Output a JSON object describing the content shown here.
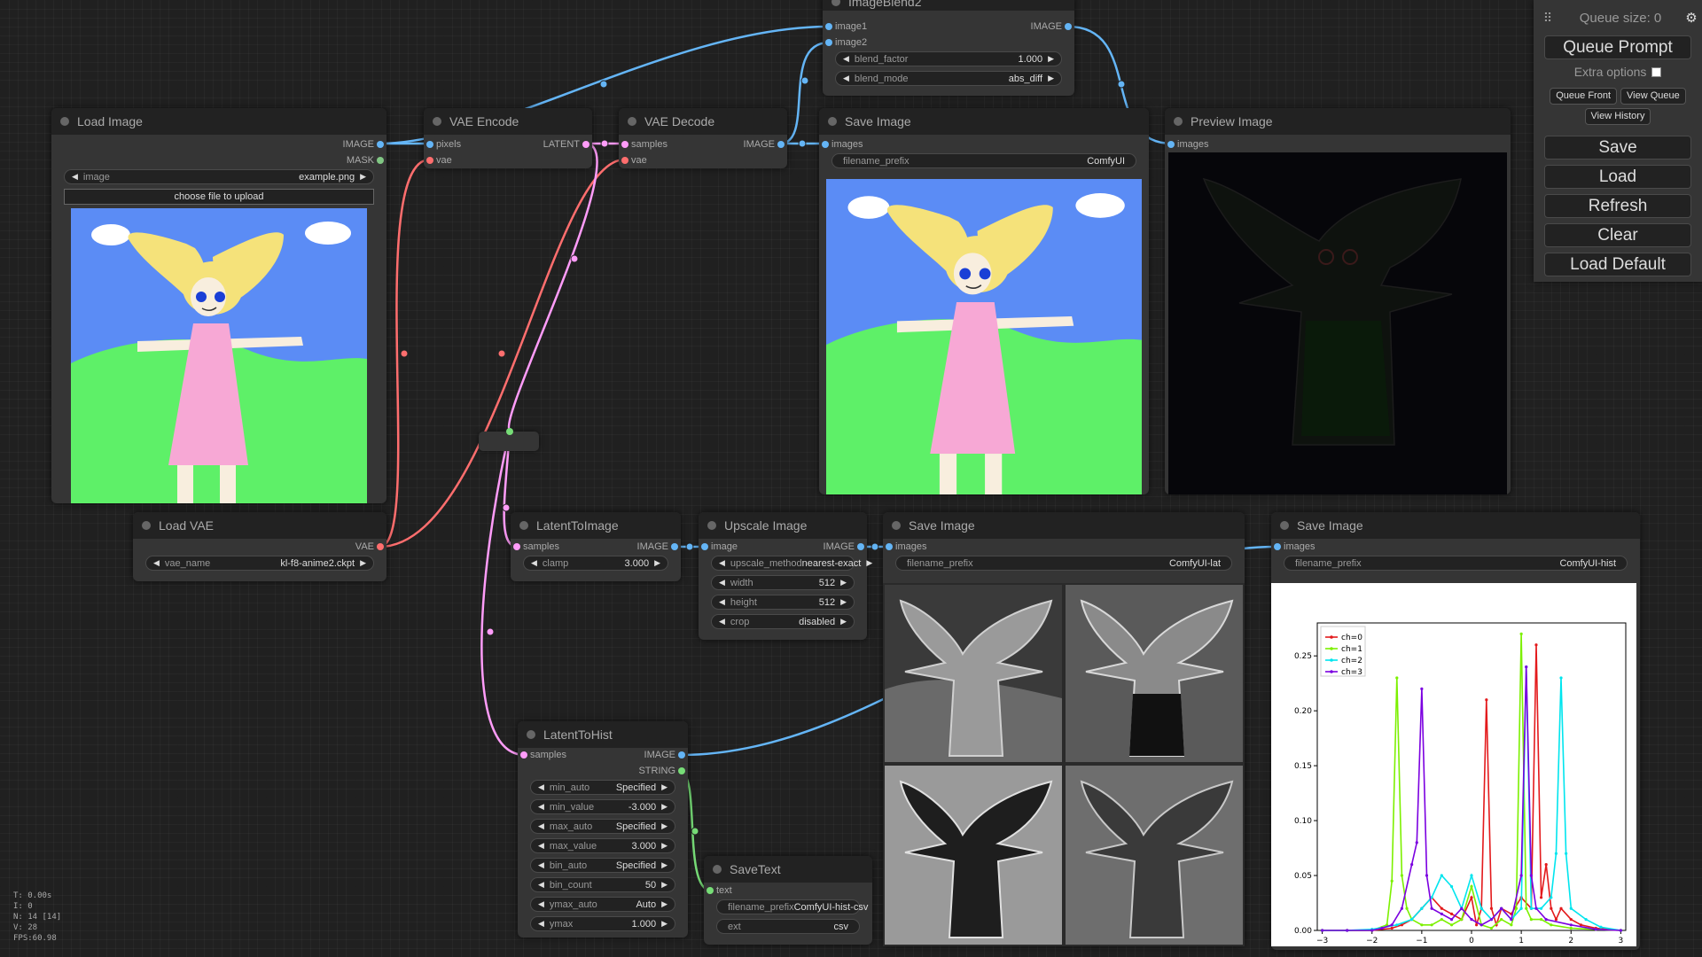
{
  "menu": {
    "queue_size": "Queue size: 0",
    "queue_prompt": "Queue Prompt",
    "extra_options": "Extra options",
    "queue_front": "Queue Front",
    "view_queue": "View Queue",
    "view_history": "View History",
    "save": "Save",
    "load": "Load",
    "refresh": "Refresh",
    "clear": "Clear",
    "load_default": "Load Default"
  },
  "stats": {
    "t": "T: 0.00s",
    "i": "I: 0",
    "n": "N: 14 [14]",
    "v": "V: 28",
    "fps": "FPS:60.98"
  },
  "nodes": {
    "load_image": {
      "title": "Load Image",
      "out_image": "IMAGE",
      "out_mask": "MASK",
      "w_image_name": "image",
      "w_image_value": "example.png",
      "upload": "choose file to upload"
    },
    "load_vae": {
      "title": "Load VAE",
      "out_vae": "VAE",
      "w_vae_name": "vae_name",
      "w_vae_value": "kl-f8-anime2.ckpt"
    },
    "vae_encode": {
      "title": "VAE Encode",
      "in_pixels": "pixels",
      "in_vae": "vae",
      "out_latent": "LATENT"
    },
    "vae_decode": {
      "title": "VAE Decode",
      "in_samples": "samples",
      "in_vae": "vae",
      "out_image": "IMAGE"
    },
    "image_blend": {
      "title": "ImageBlend2",
      "in_image1": "image1",
      "in_image2": "image2",
      "out_image": "IMAGE",
      "w_blend_factor": "blend_factor",
      "w_blend_factor_value": "1.000",
      "w_blend_mode": "blend_mode",
      "w_blend_mode_value": "abs_diff"
    },
    "save_image_1": {
      "title": "Save Image",
      "in_images": "images",
      "w_prefix": "filename_prefix",
      "w_prefix_value": "ComfyUI"
    },
    "preview_image": {
      "title": "Preview Image",
      "in_images": "images"
    },
    "latent_to_image": {
      "title": "LatentToImage",
      "in_samples": "samples",
      "out_image": "IMAGE",
      "w_clamp": "clamp",
      "w_clamp_value": "3.000"
    },
    "upscale_image": {
      "title": "Upscale Image",
      "in_image": "image",
      "out_image": "IMAGE",
      "widgets": [
        {
          "name": "upscale_method",
          "value": "nearest-exact"
        },
        {
          "name": "width",
          "value": "512"
        },
        {
          "name": "height",
          "value": "512"
        },
        {
          "name": "crop",
          "value": "disabled"
        }
      ]
    },
    "save_image_lat": {
      "title": "Save Image",
      "in_images": "images",
      "w_prefix": "filename_prefix",
      "w_prefix_value": "ComfyUI-lat"
    },
    "save_image_hist": {
      "title": "Save Image",
      "in_images": "images",
      "w_prefix": "filename_prefix",
      "w_prefix_value": "ComfyUI-hist"
    },
    "latent_to_hist": {
      "title": "LatentToHist",
      "in_samples": "samples",
      "out_image": "IMAGE",
      "out_string": "STRING",
      "widgets": [
        {
          "name": "min_auto",
          "value": "Specified"
        },
        {
          "name": "min_value",
          "value": "-3.000"
        },
        {
          "name": "max_auto",
          "value": "Specified"
        },
        {
          "name": "max_value",
          "value": "3.000"
        },
        {
          "name": "bin_auto",
          "value": "Specified"
        },
        {
          "name": "bin_count",
          "value": "50"
        },
        {
          "name": "ymax_auto",
          "value": "Auto"
        },
        {
          "name": "ymax",
          "value": "1.000"
        }
      ]
    },
    "save_text": {
      "title": "SaveText",
      "in_text": "text",
      "w_prefix": "filename_prefix",
      "w_prefix_value": "ComfyUI-hist-csv",
      "w_ext": "ext",
      "w_ext_value": "csv"
    }
  },
  "colors": {
    "image_link": "#64b5f6",
    "vae_link": "#ff6e6e",
    "latent_link": "#ff9cf9",
    "string_link": "#77dd77"
  },
  "chart_data": {
    "type": "line",
    "x_ticks": [
      "−3",
      "−2",
      "−1",
      "0",
      "1",
      "2",
      "3"
    ],
    "y_ticks": [
      "0.00",
      "0.05",
      "0.10",
      "0.15",
      "0.20",
      "0.25"
    ],
    "xlim": [
      -3.1,
      3.1
    ],
    "ylim": [
      0,
      0.28
    ],
    "legend_position": "top-left",
    "series": [
      {
        "name": "ch=0",
        "color": "#e31a1c",
        "x": [
          -3.0,
          -2.5,
          -2.0,
          -1.6,
          -1.4,
          -1.2,
          -1.0,
          -0.8,
          -0.6,
          -0.4,
          -0.2,
          0.0,
          0.1,
          0.2,
          0.3,
          0.4,
          0.5,
          0.6,
          0.8,
          1.0,
          1.2,
          1.3,
          1.4,
          1.5,
          1.6,
          1.7,
          1.8,
          2.0,
          2.2,
          2.5,
          3.0
        ],
        "y": [
          0,
          0,
          0,
          0.002,
          0.005,
          0.01,
          0.02,
          0.03,
          0.02,
          0.015,
          0.01,
          0.03,
          0.005,
          0.02,
          0.21,
          0.02,
          0.005,
          0.02,
          0.015,
          0.03,
          0.02,
          0.26,
          0.03,
          0.06,
          0.02,
          0.01,
          0.02,
          0.01,
          0.005,
          0.002,
          0
        ]
      },
      {
        "name": "ch=1",
        "color": "#7cf000",
        "x": [
          -3.0,
          -2.5,
          -2.0,
          -1.7,
          -1.6,
          -1.5,
          -1.4,
          -1.3,
          -1.2,
          -1.0,
          -0.8,
          -0.6,
          -0.4,
          -0.2,
          0.0,
          0.2,
          0.4,
          0.6,
          0.8,
          0.9,
          1.0,
          1.1,
          1.2,
          1.4,
          1.6,
          2.0,
          2.5,
          3.0
        ],
        "y": [
          0,
          0,
          0,
          0.005,
          0.045,
          0.23,
          0.05,
          0.02,
          0.01,
          0.005,
          0.005,
          0.01,
          0.005,
          0.01,
          0.04,
          0.005,
          0.002,
          0.01,
          0.005,
          0.02,
          0.27,
          0.02,
          0.01,
          0.01,
          0.005,
          0.002,
          0.001,
          0
        ]
      },
      {
        "name": "ch=2",
        "color": "#00e5ee",
        "x": [
          -3.0,
          -2.5,
          -2.0,
          -1.5,
          -1.2,
          -1.0,
          -0.8,
          -0.6,
          -0.4,
          -0.2,
          0.0,
          0.2,
          0.4,
          0.6,
          0.8,
          1.0,
          1.1,
          1.2,
          1.4,
          1.6,
          1.7,
          1.8,
          1.9,
          2.0,
          2.3,
          2.6,
          3.0
        ],
        "y": [
          0,
          0,
          0.001,
          0.005,
          0.01,
          0.02,
          0.03,
          0.05,
          0.04,
          0.02,
          0.05,
          0.02,
          0.01,
          0.02,
          0.01,
          0.02,
          0.24,
          0.02,
          0.02,
          0.03,
          0.07,
          0.23,
          0.07,
          0.02,
          0.01,
          0.003,
          0
        ]
      },
      {
        "name": "ch=3",
        "color": "#7b00e0",
        "x": [
          -3.0,
          -2.5,
          -2.0,
          -1.8,
          -1.6,
          -1.4,
          -1.2,
          -1.1,
          -1.0,
          -0.9,
          -0.8,
          -0.6,
          -0.4,
          -0.2,
          0.0,
          0.2,
          0.4,
          0.6,
          0.8,
          1.0,
          1.1,
          1.2,
          1.3,
          1.5,
          2.0,
          2.5,
          3.0
        ],
        "y": [
          0,
          0,
          0,
          0.002,
          0.005,
          0.02,
          0.06,
          0.08,
          0.22,
          0.05,
          0.02,
          0.015,
          0.01,
          0.02,
          0.01,
          0.005,
          0.01,
          0.02,
          0.01,
          0.05,
          0.24,
          0.05,
          0.02,
          0.01,
          0.005,
          0.001,
          0
        ]
      }
    ]
  }
}
